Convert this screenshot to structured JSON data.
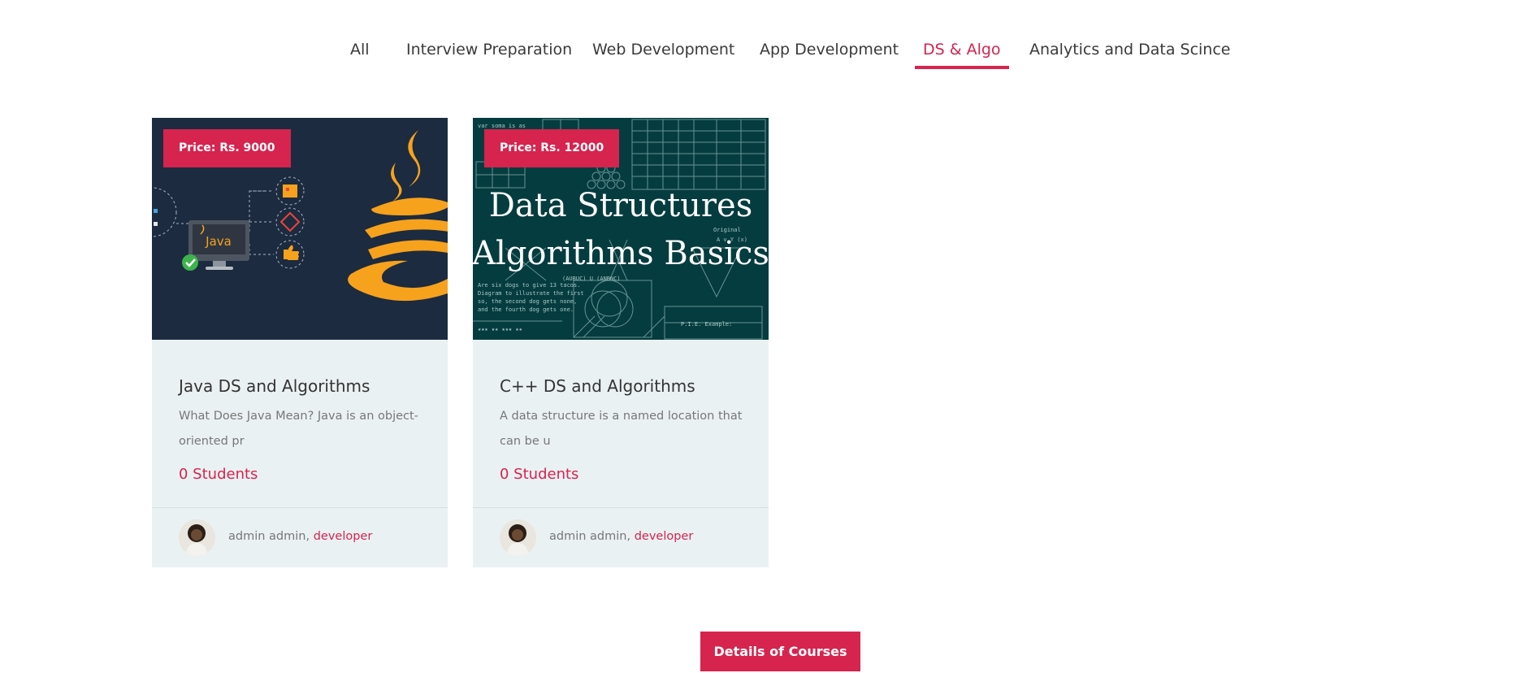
{
  "tabs": [
    "All",
    "Interview Preparation",
    "Web Development",
    "App Development",
    "DS & Algo",
    "Analytics and Data Scince"
  ],
  "active_tab": "DS & Algo",
  "courses": [
    {
      "price": "Price: Rs. 9000",
      "title": "Java DS and Algorithms",
      "description": "What Does Java Mean? Java is an object-oriented pr",
      "students": "0 Students",
      "author": "admin admin,",
      "role": "developer",
      "image_text": "Java"
    },
    {
      "price": "Price: Rs. 12000",
      "title": "C++ DS and Algorithms",
      "description": "A data structure is a named location that can be u",
      "students": "0 Students",
      "author": "admin admin,",
      "role": "developer",
      "image_line1": "Data Structures",
      "image_line2": "Algorithms Basics"
    }
  ],
  "details_button": "Details of Courses",
  "colors": {
    "accent": "#d6244e",
    "card_bg": "#eaf1f3",
    "java_bg": "#1c2b3f",
    "ds_bg": "#053c3f",
    "java_orange": "#f7a21d"
  }
}
